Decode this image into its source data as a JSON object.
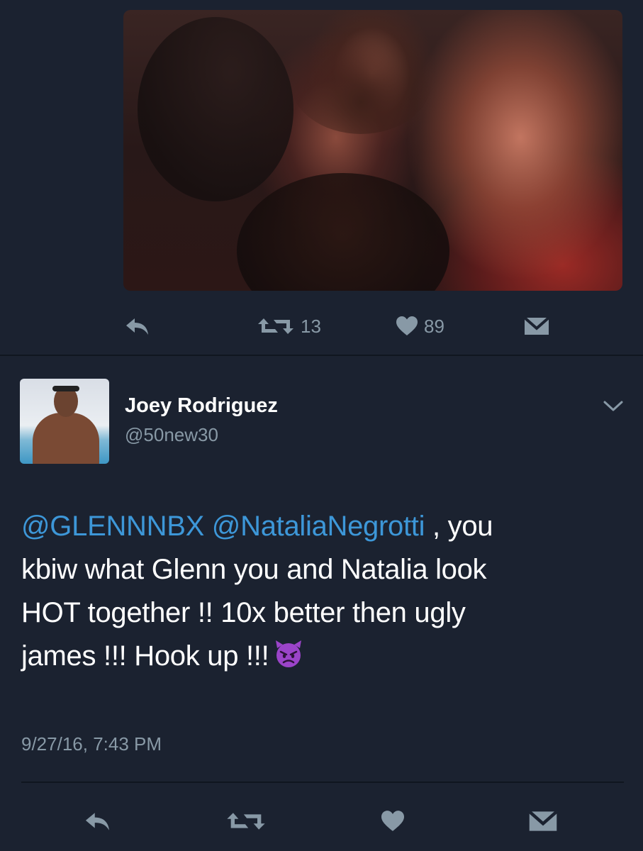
{
  "tweet_top": {
    "retweet_count": "13",
    "like_count": "89"
  },
  "tweet_main": {
    "author_name": "Joey Rodriguez",
    "author_handle": "@50new30",
    "mention_1": "@GLENNNBX",
    "mention_2": "@NataliaNegrotti",
    "text_line_1_rest": ", you",
    "text_line_2": "kbiw what Glenn you and Natalia look",
    "text_line_3": "HOT together !! 10x better then ugly",
    "text_line_4": "james !!! Hook up !!!",
    "emoji": "smiling-imp-emoji",
    "timestamp": "9/27/16, 7:43 PM"
  },
  "colors": {
    "background": "#1b2230",
    "mention": "#3d97d8",
    "secondary_text": "#8899a6",
    "icon": "#8899a6",
    "emoji_purple": "#9b44c9"
  }
}
